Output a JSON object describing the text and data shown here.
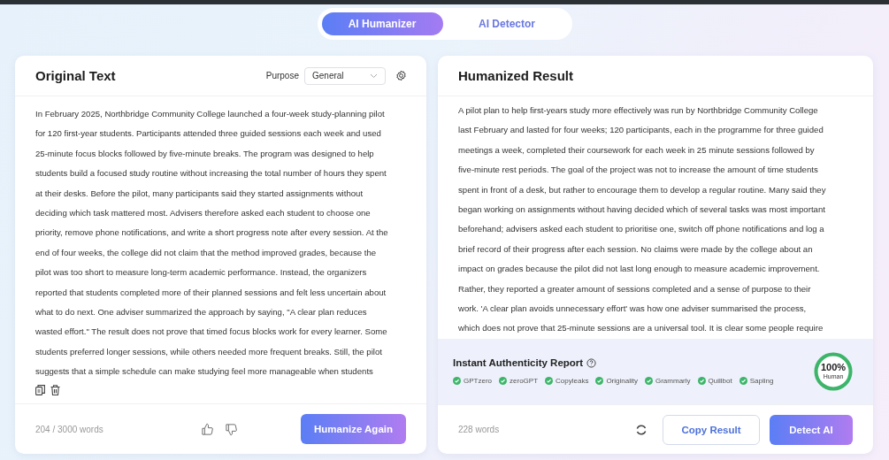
{
  "tabs": [
    {
      "label": "AI Humanizer",
      "selected": true
    },
    {
      "label": "AI Detector",
      "selected": false
    }
  ],
  "original": {
    "title": "Original Text",
    "purpose_label": "Purpose",
    "purpose_value": "General",
    "lines": [
      "In February 2025, Northbridge Community College launched a four-week study-planning pilot",
      "for 120 first-year students. Participants attended three guided sessions each week and used",
      "25-minute focus blocks followed by five-minute breaks. The program was designed to help",
      "students build a focused study routine without increasing the total number of hours they spent",
      "at their desks. Before the pilot, many participants said they started assignments without",
      "deciding which task mattered most. Advisers therefore asked each student to choose one",
      "priority, remove phone notifications, and write a short progress note after every session. At the",
      "end of four weeks, the college did not claim that the method improved grades, because the",
      "pilot was too short to measure long-term academic performance. Instead, the organizers",
      "reported that students completed more of their planned sessions and felt less uncertain about",
      "what to do next. One adviser summarized the approach by saying, \"A clear plan reduces",
      "wasted effort.\" The result does not prove that timed focus blocks work for every learner. Some",
      "students preferred longer sessions, while others needed more frequent breaks. Still, the pilot",
      "suggests that a simple schedule can make studying feel more manageable when students"
    ],
    "word_count": "204 / 3000 words",
    "action": "Humanize Again"
  },
  "result": {
    "title": "Humanized Result",
    "lines": [
      "A pilot plan to help first-years study more effectively was run by Northbridge Community College",
      "last February and lasted for four weeks; 120 participants, each in the programme for three guided",
      "meetings a week, completed their coursework for each week in 25 minute sessions followed by",
      "five-minute rest periods. The goal of the project was not to increase the amount of time students",
      "spent in front of a desk, but rather to encourage them to develop a regular routine. Many said they",
      "began working on assignments without having decided which of several tasks was most important",
      "beforehand; advisers asked each student to prioritise one, switch off phone notifications and log a",
      "brief record of their progress after each session. No claims were made by the college about an",
      "impact on grades because the pilot did not last long enough to measure academic improvement.",
      "Rather, they reported a greater amount of sessions completed and a sense of purpose to their",
      "work. 'A clear plan avoids unnecessary effort' was how one adviser summarised the process,",
      "which does not prove that 25-minute sessions are a universal tool. It is clear some people require"
    ],
    "report_title": "Instant Authenticity Report",
    "detectors": [
      {
        "name": "GPTzero",
        "passed": true
      },
      {
        "name": "zeroGPT",
        "passed": true
      },
      {
        "name": "Copyleaks",
        "passed": true
      },
      {
        "name": "Originality",
        "passed": true
      },
      {
        "name": "Grammarly",
        "passed": true
      },
      {
        "name": "Quillbot",
        "passed": true
      },
      {
        "name": "Sapling",
        "passed": true
      }
    ],
    "score": "100%",
    "score_label": "Human",
    "level": 1,
    "word_count": "228 words",
    "copy": "Copy Result",
    "detect": "Detect AI"
  }
}
